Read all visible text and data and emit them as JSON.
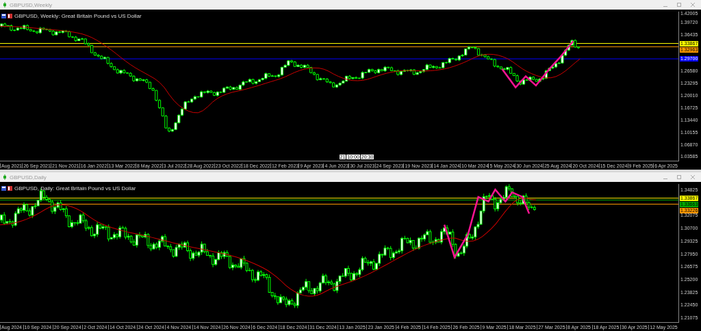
{
  "windows": [
    {
      "title": "GBPUSD,Weekly",
      "chart_title": "GBPUSD, Weekly:  Great Britain Pound vs US Dollar",
      "price_labels": [
        "1.42005",
        "1.39720",
        "1.36435",
        "1.26580",
        "1.23295",
        "1.20010",
        "1.16725",
        "1.13440",
        "1.10155",
        "1.06870",
        "1.03585"
      ],
      "level_labels": [
        {
          "text": "1.33867",
          "color": "#ffff00"
        },
        {
          "text": "1.32963",
          "color": "#ff9900"
        },
        {
          "text": "1.29700",
          "color": "#0000ff"
        }
      ],
      "cursor_labels": [
        "21",
        "10:00",
        "20:30"
      ],
      "date_labels": [
        "Aug 2021",
        "26 Sep 2021",
        "21 Nov 2021",
        "16 Jan 2022",
        "13 Mar 2022",
        "8 May 2022",
        "3 Jul 2022",
        "28 Aug 2022",
        "23 Oct 2022",
        "18 Dec 2022",
        "12 Feb 2023",
        "9 Apr 2023",
        "4 Jun 2023",
        "30 Jul 2023",
        "24 Sep 2023",
        "19 Nov 2023",
        "14 Jan 2024",
        "10 Mar 2024",
        "5 May 2024",
        "30 Jun 2024",
        "25 Aug 2024",
        "20 Oct 2024",
        "15 Dec 2024",
        "9 Feb 2025",
        "6 Apr 2025"
      ]
    },
    {
      "title": "GBPUSD,Daily",
      "chart_title": "GBPUSD, Daily:  Great Britain Pound vs US Dollar",
      "price_labels": [
        "1.34825",
        "1.32075",
        "1.30700",
        "1.29325",
        "1.27950",
        "1.26575",
        "1.25200",
        "1.23825",
        "1.22450",
        "1.21075"
      ],
      "level_labels": [
        {
          "text": "1.33867",
          "color": "#ffff00"
        },
        {
          "text": "1.33663",
          "color": "#00aa00"
        },
        {
          "text": "1.33226",
          "color": "#ff9900"
        }
      ],
      "date_labels": [
        "Aug 2024",
        "10 Sep 2024",
        "20 Sep 2024",
        "2 Oct 2024",
        "14 Oct 2024",
        "24 Oct 2024",
        "4 Nov 2024",
        "14 Nov 2024",
        "26 Nov 2024",
        "6 Dec 2024",
        "18 Dec 2024",
        "31 Dec 2024",
        "13 Jan 2025",
        "23 Jan 2025",
        "4 Feb 2025",
        "14 Feb 2025",
        "26 Feb 2025",
        "9 Mar 2025",
        "18 Mar 2025",
        "27 Mar 2025",
        "8 Apr 2025",
        "18 Apr 2025",
        "30 Apr 2025",
        "12 May 2025"
      ]
    }
  ]
}
